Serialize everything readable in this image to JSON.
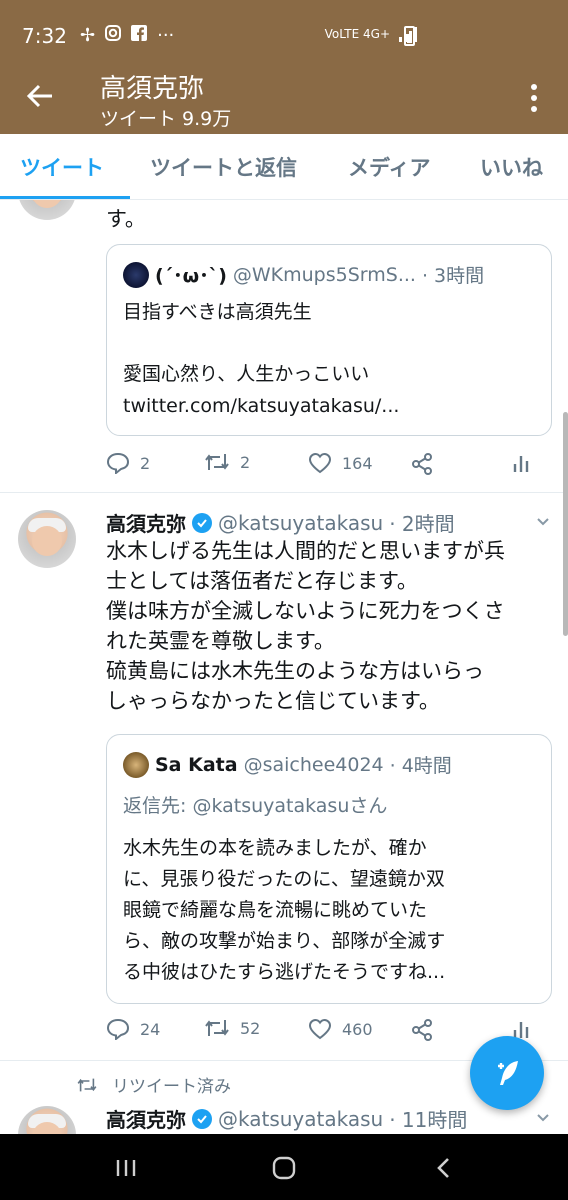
{
  "status": {
    "time": "7:32",
    "left_icons": [
      "pinwheel-icon",
      "instagram-icon",
      "facebook-icon",
      "more-dots-icon"
    ],
    "network": "VoLTE 4G+"
  },
  "header": {
    "title": "高須克弥",
    "subtitle": "ツイート 9.9万"
  },
  "tabs": [
    {
      "label": "ツイート",
      "active": true
    },
    {
      "label": "ツイートと返信",
      "active": false
    },
    {
      "label": "メディア",
      "active": false
    },
    {
      "label": "いいね",
      "active": false
    }
  ],
  "tweets": [
    {
      "text_tail": "す。",
      "quote": {
        "name": "(´･ω･`)",
        "handle": "@WKmups5SrmS...",
        "time": "· 3時間",
        "lines": [
          "目指すべきは高須先生",
          "",
          "愛国心然り、人生かっこいい",
          "twitter.com/katsuyatakasu/..."
        ]
      },
      "actions": {
        "replies": "2",
        "retweets": "2",
        "likes": "164"
      }
    },
    {
      "name": "高須克弥",
      "handle": "@katsuyatakasu",
      "time": "· 2時間",
      "lines": [
        "水木しげる先生は人間的だと思いますが兵",
        "士としては落伍者だと存じます。",
        "僕は味方が全滅しないように死力をつくさ",
        "れた英霊を尊敬します。",
        "硫黄島には水木先生のような方はいらっ",
        "しゃっらなかったと信じています。"
      ],
      "quote": {
        "name": "Sa Kata",
        "handle": "@saichee4024",
        "time": "· 4時間",
        "reply_to": "返信先: @katsuyatakasuさん",
        "lines": [
          "水木先生の本を読みましたが、確か",
          "に、見張り役だったのに、望遠鏡か双",
          "眼鏡で綺麗な鳥を流暢に眺めていた",
          "ら、敵の攻撃が始まり、部隊が全滅す",
          "る中彼はひたすら逃げたそうですね..."
        ]
      },
      "actions": {
        "replies": "24",
        "retweets": "52",
        "likes": "460"
      }
    },
    {
      "retweeted_label": "リツイート済み",
      "name": "高須克弥",
      "handle": "@katsuyatakasu",
      "time": "· 11時間"
    }
  ],
  "colors": {
    "header_bg": "#8a6a45",
    "accent": "#1da1f2",
    "muted": "#657786"
  }
}
